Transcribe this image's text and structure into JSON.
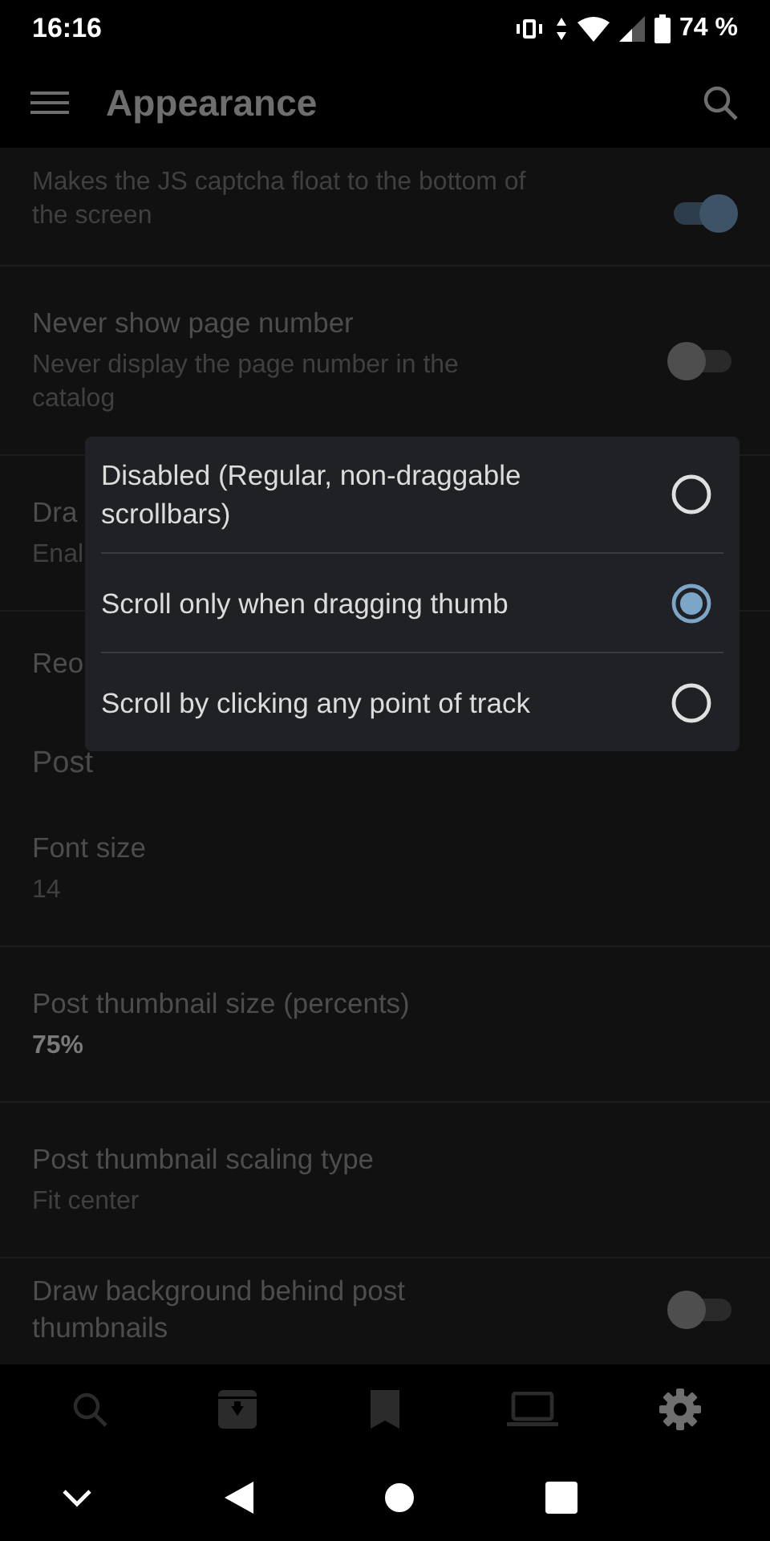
{
  "status_bar": {
    "time": "16:16",
    "battery": "74 %"
  },
  "toolbar": {
    "title": "Appearance"
  },
  "settings": [
    {
      "kind": "switch",
      "description": "Makes the JS captcha float to the bottom of the screen",
      "on": true
    },
    {
      "kind": "switch",
      "title": "Never show page number",
      "description": "Never display the page number in the catalog",
      "on": false
    },
    {
      "kind": "text",
      "title": "Dra",
      "description": "Enal"
    },
    {
      "kind": "text",
      "title": "Reo"
    },
    {
      "kind": "header",
      "title": "Post"
    },
    {
      "kind": "text",
      "title": "Font size",
      "description": "14"
    },
    {
      "kind": "value",
      "title": "Post thumbnail size (percents)",
      "description": "75%"
    },
    {
      "kind": "text",
      "title": "Post thumbnail scaling type",
      "description": "Fit center"
    },
    {
      "kind": "switch",
      "title": "Draw background behind post thumbnails",
      "on": false
    }
  ],
  "dialog": {
    "options": [
      {
        "label": "Disabled (Regular, non-draggable scrollbars)",
        "selected": false
      },
      {
        "label": "Scroll only when dragging thumb",
        "selected": true
      },
      {
        "label": "Scroll by clicking any point of track",
        "selected": false
      }
    ]
  },
  "bottom_nav": [
    {
      "selected": false
    },
    {
      "selected": false
    },
    {
      "selected": false
    },
    {
      "selected": false
    },
    {
      "selected": true
    }
  ]
}
